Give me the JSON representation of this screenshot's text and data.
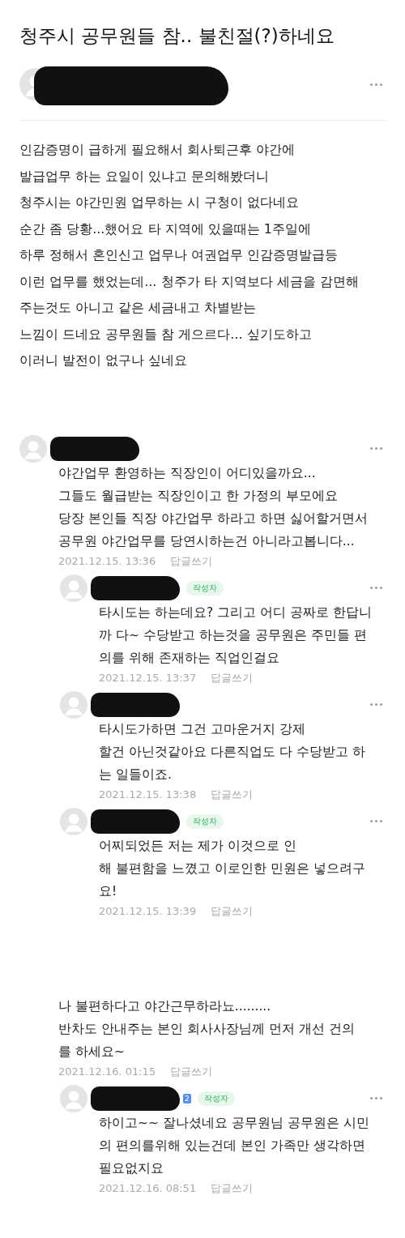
{
  "post": {
    "title": "청주시 공무원들 참.. 불친절(?)하네요",
    "author_redacted": true,
    "body_lines": [
      "인감증명이 급하게 필요해서 회사퇴근후 야간에",
      "발급업무 하는 요일이 있냐고 문의해봤더니",
      "청주시는 야간민원 업무하는 시 구청이 없다네요",
      "순간 좀 당황...했어요 타 지역에 있을때는 1주일에",
      "하루 정해서 혼인신고 업무나 여권업무 인감증명발급등",
      "이런 업무를 했었는데... 청주가 타 지역보다 세금을 감면해",
      "주는것도 아니고 같은 세금내고 차별받는",
      "느낌이 드네요 공무원들 참 게으르다... 싶기도하고",
      "이러니 발전이 없구나 싶네요"
    ]
  },
  "comments": [
    {
      "header_shown": true,
      "text_lines": [
        "야간업무 환영하는 직장인이 어디있을까요...",
        "그들도 월급받는 직장인이고 한 가정의 부모에요",
        "당장 본인들 직장 야간업무 하라고 하면 싫어할거면서",
        "공무원 야간업무를 당연시하는건 아니라고봅니다..."
      ],
      "date": "2021.12.15. 13:36",
      "reply_label": "답글쓰기",
      "replies": [
        {
          "header_shown": true,
          "writer_badge": "작성자",
          "text_lines": [
            "타시도는 하는데요? 그리고 어디 공짜로 한답니",
            "까 다~ 수당받고 하는것을 공무원은 주민들 편",
            "의를 위해 존재하는 직업인걸요"
          ],
          "date": "2021.12.15. 13:37",
          "reply_label": "답글쓰기"
        },
        {
          "header_shown": true,
          "text_lines": [
            "타시도가하면 그건 고마운거지 강제",
            "할건 아닌것같아요 다른직업도 다 수당받고 하",
            "는 일들이죠."
          ],
          "date": "2021.12.15. 13:38",
          "reply_label": "답글쓰기"
        },
        {
          "header_shown": true,
          "writer_badge": "작성자",
          "text_lines": [
            "어찌되었든 저는 제가 이것으로 인",
            "해 불편함을 느꼈고 이로인한 민원은 넣으려구",
            "요!"
          ],
          "date": "2021.12.15. 13:39",
          "reply_label": "답글쓰기"
        }
      ]
    },
    {
      "header_shown": false,
      "text_lines": [
        "나 불편하다고 야간근무하라뇨.........",
        "반차도 안내주는 본인 회사사장님께 먼저 개선 건의",
        "를 하세요~"
      ],
      "date": "2021.12.16. 01:15",
      "reply_label": "답글쓰기",
      "replies": [
        {
          "header_shown": true,
          "level_badge": "2",
          "writer_badge": "작성자",
          "text_lines": [
            "하이고~~ 잘나셨네요 공무원님 공무원은 시민",
            "의 편의를위해 있는건데 본인 가족만 생각하면",
            "필요없지요"
          ],
          "date": "2021.12.16. 08:51",
          "reply_label": "답글쓰기"
        }
      ]
    }
  ]
}
